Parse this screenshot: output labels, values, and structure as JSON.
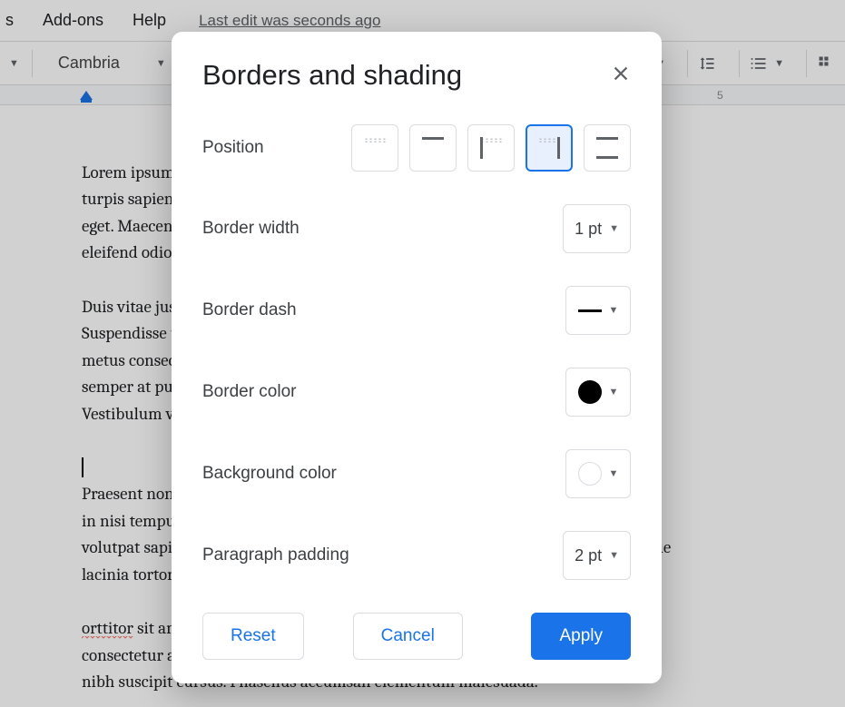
{
  "menubar": {
    "items": [
      "s",
      "Add-ons",
      "Help"
    ],
    "last_edit": "Last edit was seconds ago"
  },
  "toolbar": {
    "font": "Cambria"
  },
  "ruler": {
    "marker": "5"
  },
  "doc": {
    "p1": "Lorem ipsum dolor sit amet, consectetur adipiscing elit mauris. Suspendisse d\nturpis sapien pulvinar, non consectetur augue vestibulum iam, eu mollis urna o\neget. Maecenas scelerisque diam et neque suscipit, feugiat ac faucibus urna est. Se\neleifend odio.",
    "p2": "Duis vitae justo id justo volutpat condimentum. Pellentesque nec maximus d\nSuspendisse ultrices sapien feugiat, blandit pulvinar. Proin venenatis lorem\nmetus consectetur, non imperdiet sapien mollis fermentum. Nullam lectus ip\nsemper at pulvinar eu, interdum et dolor felis hendrerit ante. Pellentesque eg\nVestibulum vehicula nunc eget porta pharetra.",
    "p3": "Praesent non eros elit varius laoreet, purus eu sodales vestibulum ullamcorpe\nin nisi tempus pretium. Aenean turpis dolor, ultrices pulvinar facilisis erat. Quis\nvolutpat sapien at enim interdum interdum. Sed ut tortor magna non, rutrum neque\nlacinia tortor.",
    "p4_pre": "orttitor",
    "p4_post": " sit amet tempor eu, tristique id lectus. Lorem ipsum dolor sit ame\nconsectetur adipiscing elit. Etiam nec dictum libero venenatis nisi. Suspendisse ne\nnibh suscipit cursus. Phasellus accumsan elementum malesuada."
  },
  "dialog": {
    "title": "Borders and shading",
    "labels": {
      "position": "Position",
      "border_width": "Border width",
      "border_dash": "Border dash",
      "border_color": "Border color",
      "background_color": "Background color",
      "paragraph_padding": "Paragraph padding"
    },
    "values": {
      "border_width": "1 pt",
      "paragraph_padding": "2 pt"
    },
    "buttons": {
      "reset": "Reset",
      "cancel": "Cancel",
      "apply": "Apply"
    },
    "selected_position_index": 3
  }
}
